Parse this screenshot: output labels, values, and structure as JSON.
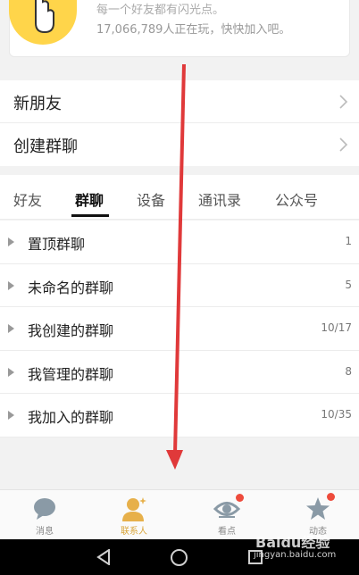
{
  "promo": {
    "line1": "每一个好友都有闪光点。",
    "line2": "17,066,789人正在玩，快快加入吧。"
  },
  "menu": {
    "new_friends": "新朋友",
    "create_group": "创建群聊"
  },
  "tabs": [
    {
      "label": "好友"
    },
    {
      "label": "群聊"
    },
    {
      "label": "设备"
    },
    {
      "label": "通讯录"
    },
    {
      "label": "公众号"
    }
  ],
  "groups": [
    {
      "name": "置顶群聊",
      "count": "1"
    },
    {
      "name": "未命名的群聊",
      "count": "5"
    },
    {
      "name": "我创建的群聊",
      "count": "10/17"
    },
    {
      "name": "我管理的群聊",
      "count": "8"
    },
    {
      "name": "我加入的群聊",
      "count": "10/35"
    }
  ],
  "bottom_nav": [
    {
      "label": "消息",
      "icon": "message-bubble-icon"
    },
    {
      "label": "联系人",
      "icon": "contacts-person-icon"
    },
    {
      "label": "看点",
      "icon": "eye-icon"
    },
    {
      "label": "动态",
      "icon": "star-icon"
    }
  ],
  "watermark": {
    "brand": "Baidu经验",
    "url": "jingyan.baidu.com"
  },
  "colors": {
    "accent": "#d9a53a",
    "badge": "#ee4b3c",
    "arrow": "#e0393a"
  }
}
